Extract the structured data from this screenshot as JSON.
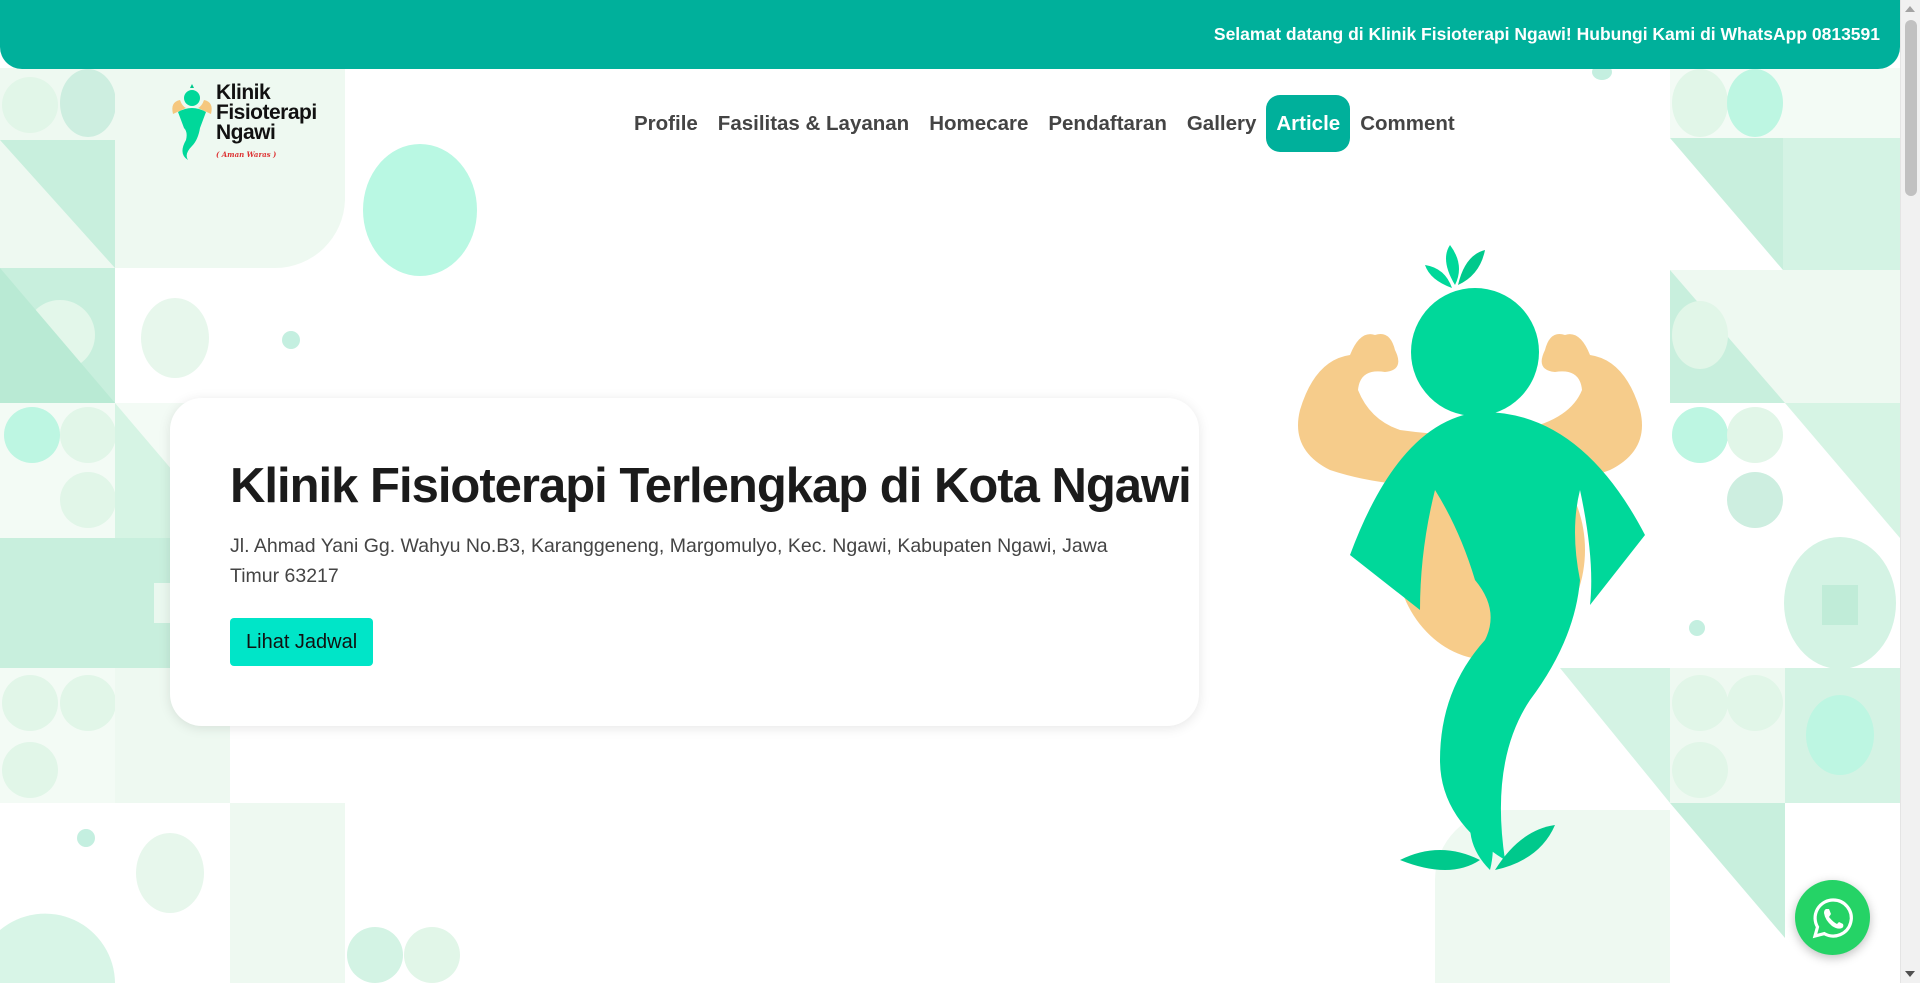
{
  "topbar": {
    "message": "Selamat datang di Klinik Fisioterapi Ngawi! Hubungi Kami di WhatsApp 0813591"
  },
  "logo": {
    "line1": "Klinik",
    "line2": "Fisioterapi",
    "line3": "Ngawi",
    "tagline": "( Aman Waras )"
  },
  "nav": {
    "items": [
      {
        "label": "Profile"
      },
      {
        "label": "Fasilitas & Layanan"
      },
      {
        "label": "Homecare"
      },
      {
        "label": "Pendaftaran"
      },
      {
        "label": "Gallery"
      },
      {
        "label": "Article"
      },
      {
        "label": "Comment"
      }
    ]
  },
  "hero": {
    "title": "Klinik Fisioterapi Terlengkap di Kota Ngawi",
    "address": "Jl. Ahmad Yani Gg. Wahyu No.B3, Karanggeneng, Margomulyo, Kec. Ngawi, Kabupaten Ngawi, Jawa Timur 63217",
    "button_label": "Lihat Jadwal"
  },
  "colors": {
    "primary": "#00b09b",
    "button": "#00e5c8",
    "whatsapp": "#25d366",
    "mascot": "#00d89a",
    "arms": "#f5c77e"
  },
  "icons": {
    "whatsapp": "whatsapp-icon"
  }
}
